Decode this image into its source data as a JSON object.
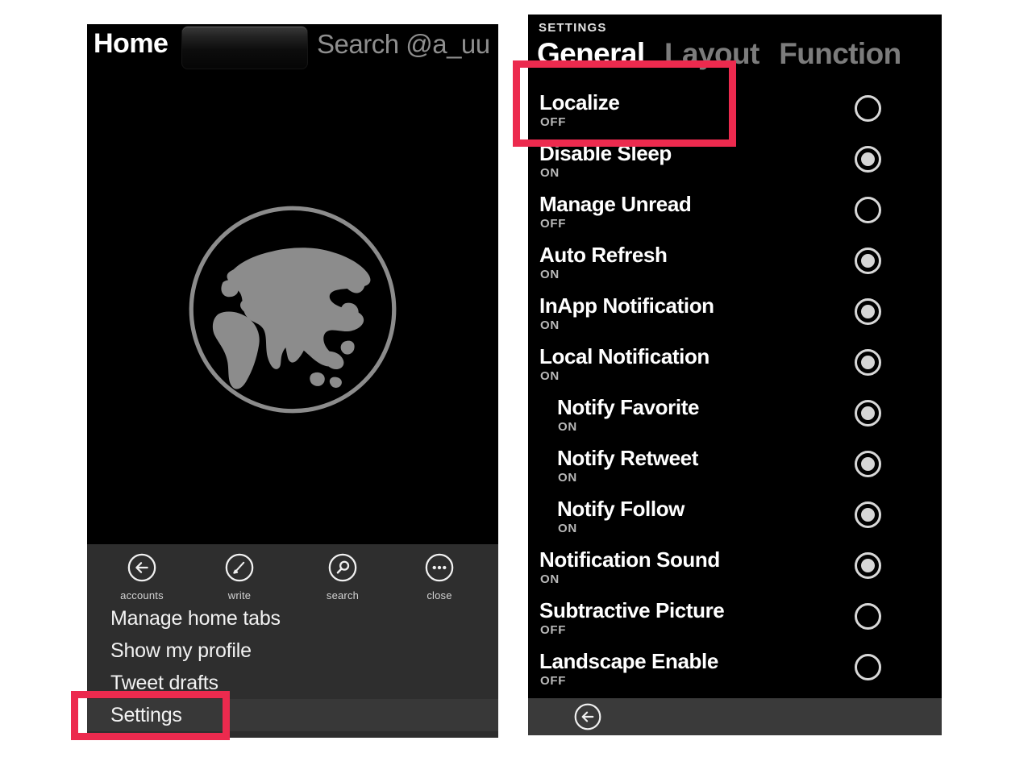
{
  "left_phone": {
    "header": {
      "title": "Home",
      "tab_button": "home-tab-button",
      "search_label": "Search @a_uu"
    },
    "globe_icon": "globe-icon",
    "toolbar": [
      {
        "icon": "back-arrow-icon",
        "label": "accounts"
      },
      {
        "icon": "pencil-icon",
        "label": "write"
      },
      {
        "icon": "magnifier-icon",
        "label": "search"
      },
      {
        "icon": "ellipsis-icon",
        "label": "close"
      }
    ],
    "menu_items": [
      {
        "label": "Manage home tabs",
        "selected": false
      },
      {
        "label": "Show my profile",
        "selected": false
      },
      {
        "label": "Tweet drafts",
        "selected": false
      },
      {
        "label": "Settings",
        "selected": true
      }
    ]
  },
  "right_phone": {
    "kicker": "SETTINGS",
    "tabs": [
      {
        "label": "General",
        "active": true
      },
      {
        "label": "Layout",
        "active": false
      },
      {
        "label": "Function",
        "active": false
      }
    ],
    "settings": [
      {
        "label": "Localize",
        "value": "OFF",
        "on": false,
        "indent": false
      },
      {
        "label": "Disable Sleep",
        "value": "ON",
        "on": true,
        "indent": false
      },
      {
        "label": "Manage Unread",
        "value": "OFF",
        "on": false,
        "indent": false
      },
      {
        "label": "Auto Refresh",
        "value": "ON",
        "on": true,
        "indent": false
      },
      {
        "label": "InApp Notification",
        "value": "ON",
        "on": true,
        "indent": false
      },
      {
        "label": "Local Notification",
        "value": "ON",
        "on": true,
        "indent": false
      },
      {
        "label": "Notify Favorite",
        "value": "ON",
        "on": true,
        "indent": true
      },
      {
        "label": "Notify Retweet",
        "value": "ON",
        "on": true,
        "indent": true
      },
      {
        "label": "Notify Follow",
        "value": "ON",
        "on": true,
        "indent": true
      },
      {
        "label": "Notification Sound",
        "value": "ON",
        "on": true,
        "indent": false
      },
      {
        "label": "Subtractive Picture",
        "value": "OFF",
        "on": false,
        "indent": false
      },
      {
        "label": "Landscape Enable",
        "value": "OFF",
        "on": false,
        "indent": false
      }
    ],
    "bottom_bar": {
      "back_icon": "back-arrow-icon"
    }
  },
  "annotations": {
    "highlight_color": "#ec2a4e",
    "boxes": [
      {
        "name": "localize-highlight"
      },
      {
        "name": "settings-highlight"
      }
    ]
  }
}
